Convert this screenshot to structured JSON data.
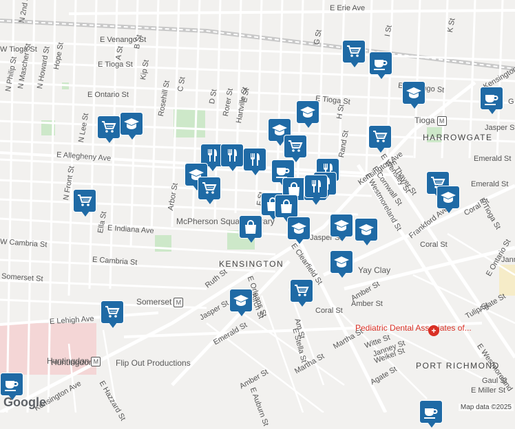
{
  "streets": [
    {
      "text": "E Erie Ave",
      "name": "street-e-erie-ave"
    },
    {
      "text": "N 2nd St",
      "name": "street-n-2nd-st"
    },
    {
      "text": "W Tioga St",
      "name": "street-w-tioga-st"
    },
    {
      "text": "E Venango St",
      "name": "street-e-venango-st"
    },
    {
      "text": "N Mascher St",
      "name": "street-n-mascher-st"
    },
    {
      "text": "N Howard St",
      "name": "street-n-howard-st"
    },
    {
      "text": "Hope St",
      "name": "street-hope-st"
    },
    {
      "text": "A St",
      "name": "street-a-st"
    },
    {
      "text": "B St",
      "name": "street-b-st"
    },
    {
      "text": "Kip St",
      "name": "street-kip-st"
    },
    {
      "text": "E Tioga St",
      "name": "street-e-tioga-st"
    },
    {
      "text": "E Ontario St",
      "name": "street-e-ontario-st"
    },
    {
      "text": "N Philip St",
      "name": "street-n-philip-st"
    },
    {
      "text": "Rosehill St",
      "name": "street-rosehill-st"
    },
    {
      "text": "C St",
      "name": "street-c-st"
    },
    {
      "text": "D St",
      "name": "street-d-st"
    },
    {
      "text": "Rorer St",
      "name": "street-rorer-st"
    },
    {
      "text": "Hartville St",
      "name": "street-hartville-st"
    },
    {
      "text": "E St",
      "name": "street-e-st"
    },
    {
      "text": "G St",
      "name": "street-g-st"
    },
    {
      "text": "H St",
      "name": "street-h-st"
    },
    {
      "text": "I St",
      "name": "street-i-st"
    },
    {
      "text": "K St",
      "name": "street-k-st"
    },
    {
      "text": "E Allegheny Ave",
      "name": "street-e-allegheny-ave"
    },
    {
      "text": "N Lee St",
      "name": "street-n-lee-st"
    },
    {
      "text": "N Front St",
      "name": "street-n-front-st"
    },
    {
      "text": "Arbor St",
      "name": "street-arbor-st"
    },
    {
      "text": "F St",
      "name": "street-f-st"
    },
    {
      "text": "Rand St",
      "name": "street-rand-st"
    },
    {
      "text": "Kensington Ave",
      "name": "street-kensington-ave"
    },
    {
      "text": "E Thayer St",
      "name": "street-e-thayer-st"
    },
    {
      "text": "E Wensley St",
      "name": "street-e-wensley-st"
    },
    {
      "text": "E Cornwall St",
      "name": "street-e-cornwall-st"
    },
    {
      "text": "E Westmoreland St",
      "name": "street-e-westmoreland-st"
    },
    {
      "text": "Emerald St",
      "name": "street-emerald-st"
    },
    {
      "text": "Jasper St",
      "name": "street-jasper-st"
    },
    {
      "text": "Ella St",
      "name": "street-ella-st"
    },
    {
      "text": "E Indiana Ave",
      "name": "street-e-indiana-ave"
    },
    {
      "text": "W Cambria St",
      "name": "street-w-cambria-st"
    },
    {
      "text": "E Cambria St",
      "name": "street-e-cambria-st"
    },
    {
      "text": "Somerset St",
      "name": "street-somerset-st"
    },
    {
      "text": "Frankford Ave",
      "name": "street-frankford-ave"
    },
    {
      "text": "Coral St",
      "name": "street-coral-st"
    },
    {
      "text": "E Tioga St",
      "name": "street-e-tioga-st-east"
    },
    {
      "text": "E Clearfield St",
      "name": "street-e-clearfield-st"
    },
    {
      "text": "Ruth St",
      "name": "street-ruth-st"
    },
    {
      "text": "E Orleans St",
      "name": "street-e-orleans-st"
    },
    {
      "text": "Birch St",
      "name": "street-birch-st"
    },
    {
      "text": "Amber St",
      "name": "street-amber-st"
    },
    {
      "text": "Tulip St",
      "name": "street-tulip-st"
    },
    {
      "text": "Agate St",
      "name": "street-agate-st"
    },
    {
      "text": "E Ontario St",
      "name": "street-e-ontario-st-east"
    },
    {
      "text": "E Lehigh Ave",
      "name": "street-e-lehigh-ave"
    },
    {
      "text": "Emerald St",
      "name": "street-emerald-st-south"
    },
    {
      "text": "Am St",
      "name": "street-am-st"
    },
    {
      "text": "E Stella St",
      "name": "street-e-stella-st"
    },
    {
      "text": "Martha St",
      "name": "street-martha-st"
    },
    {
      "text": "Witte St",
      "name": "street-witte-st"
    },
    {
      "text": "Janney St",
      "name": "street-janney-st"
    },
    {
      "text": "Weikel St",
      "name": "street-weikel-st"
    },
    {
      "text": "E Westmoreland",
      "name": "street-e-westmoreland-south"
    },
    {
      "text": "Huntingdon",
      "name": "street-huntingdon"
    },
    {
      "text": "Kensington Ave",
      "name": "street-kensington-ave-south"
    },
    {
      "text": "E Hazzard St",
      "name": "street-e-hazzard-st"
    },
    {
      "text": "Amber St",
      "name": "street-amber-st-south"
    },
    {
      "text": "E Auburn St",
      "name": "street-e-auburn-st"
    },
    {
      "text": "Gaul St",
      "name": "street-gaul-st"
    },
    {
      "text": "E Miller St",
      "name": "street-e-miller-st"
    },
    {
      "text": "Agate St",
      "name": "street-agate-st-south"
    },
    {
      "text": "Martha St",
      "name": "street-martha-st-south"
    },
    {
      "text": "Jasper St",
      "name": "street-jasper-st-east"
    },
    {
      "text": "Jasper St",
      "name": "street-jasper-st-south"
    },
    {
      "text": "Somerset",
      "name": "street-somerset-station"
    },
    {
      "text": "Kensington",
      "name": "street-kensington-ne"
    },
    {
      "text": "Janne",
      "name": "street-janne"
    },
    {
      "text": "G",
      "name": "street-g-ne"
    },
    {
      "text": "Emerald St",
      "name": "street-emerald-st-east"
    },
    {
      "text": "Coral St",
      "name": "street-coral-st-east"
    },
    {
      "text": "Amber St",
      "name": "street-amber-st-east"
    },
    {
      "text": "Coral St",
      "name": "street-coral-st-south"
    }
  ],
  "areas": {
    "kensington": "KENSINGTON",
    "harrowgate": "HARROWGATE",
    "port_richmond": "PORT RICHMOND"
  },
  "places": {
    "library": "McPherson Square Library",
    "tioga": "Tioga",
    "somerset": "Somerset",
    "huntingdon": "Huntingdon",
    "flipout": "Flip Out Productions",
    "yayclay": "Yay Clay",
    "dental": "Pediatric Dental Associates of..."
  },
  "footer": {
    "brand": "Google",
    "attribution": "Map data ©2025"
  },
  "colors": {
    "marker": "#1f6aa5",
    "park": "#cde8c9",
    "pink_area": "#f4d6d6",
    "dental_red": "#d93025"
  },
  "markers": [
    {
      "type": "grocery-cart-icon"
    },
    {
      "type": "cafe-cup-icon"
    },
    {
      "type": "grocery-cart-icon"
    },
    {
      "type": "cafe-cup-icon"
    },
    {
      "type": "school-cap-icon"
    },
    {
      "type": "grocery-cart-icon"
    },
    {
      "type": "school-cap-icon"
    },
    {
      "type": "school-cap-icon"
    },
    {
      "type": "grocery-cart-icon"
    },
    {
      "type": "grocery-cart-icon"
    },
    {
      "type": "restaurant-icon"
    },
    {
      "type": "restaurant-icon"
    },
    {
      "type": "restaurant-icon"
    },
    {
      "type": "school-cap-icon"
    },
    {
      "type": "grocery-cart-icon"
    },
    {
      "type": "cafe-cup-icon"
    },
    {
      "type": "restaurant-icon"
    },
    {
      "type": "shopping-bag-icon"
    },
    {
      "type": "shopping-bag-icon"
    },
    {
      "type": "shopping-bag-icon"
    },
    {
      "type": "restaurant-icon"
    },
    {
      "type": "grocery-cart-icon"
    },
    {
      "type": "school-cap-icon"
    },
    {
      "type": "grocery-cart-icon"
    },
    {
      "type": "shopping-bag-icon"
    },
    {
      "type": "restaurant-icon"
    },
    {
      "type": "shopping-bag-icon"
    },
    {
      "type": "school-cap-icon"
    },
    {
      "type": "school-cap-icon"
    },
    {
      "type": "school-cap-icon"
    },
    {
      "type": "school-cap-icon"
    },
    {
      "type": "grocery-cart-icon"
    },
    {
      "type": "school-cap-icon"
    },
    {
      "type": "school-cap-icon"
    },
    {
      "type": "cafe-cup-icon"
    },
    {
      "type": "cafe-cup-icon"
    }
  ]
}
